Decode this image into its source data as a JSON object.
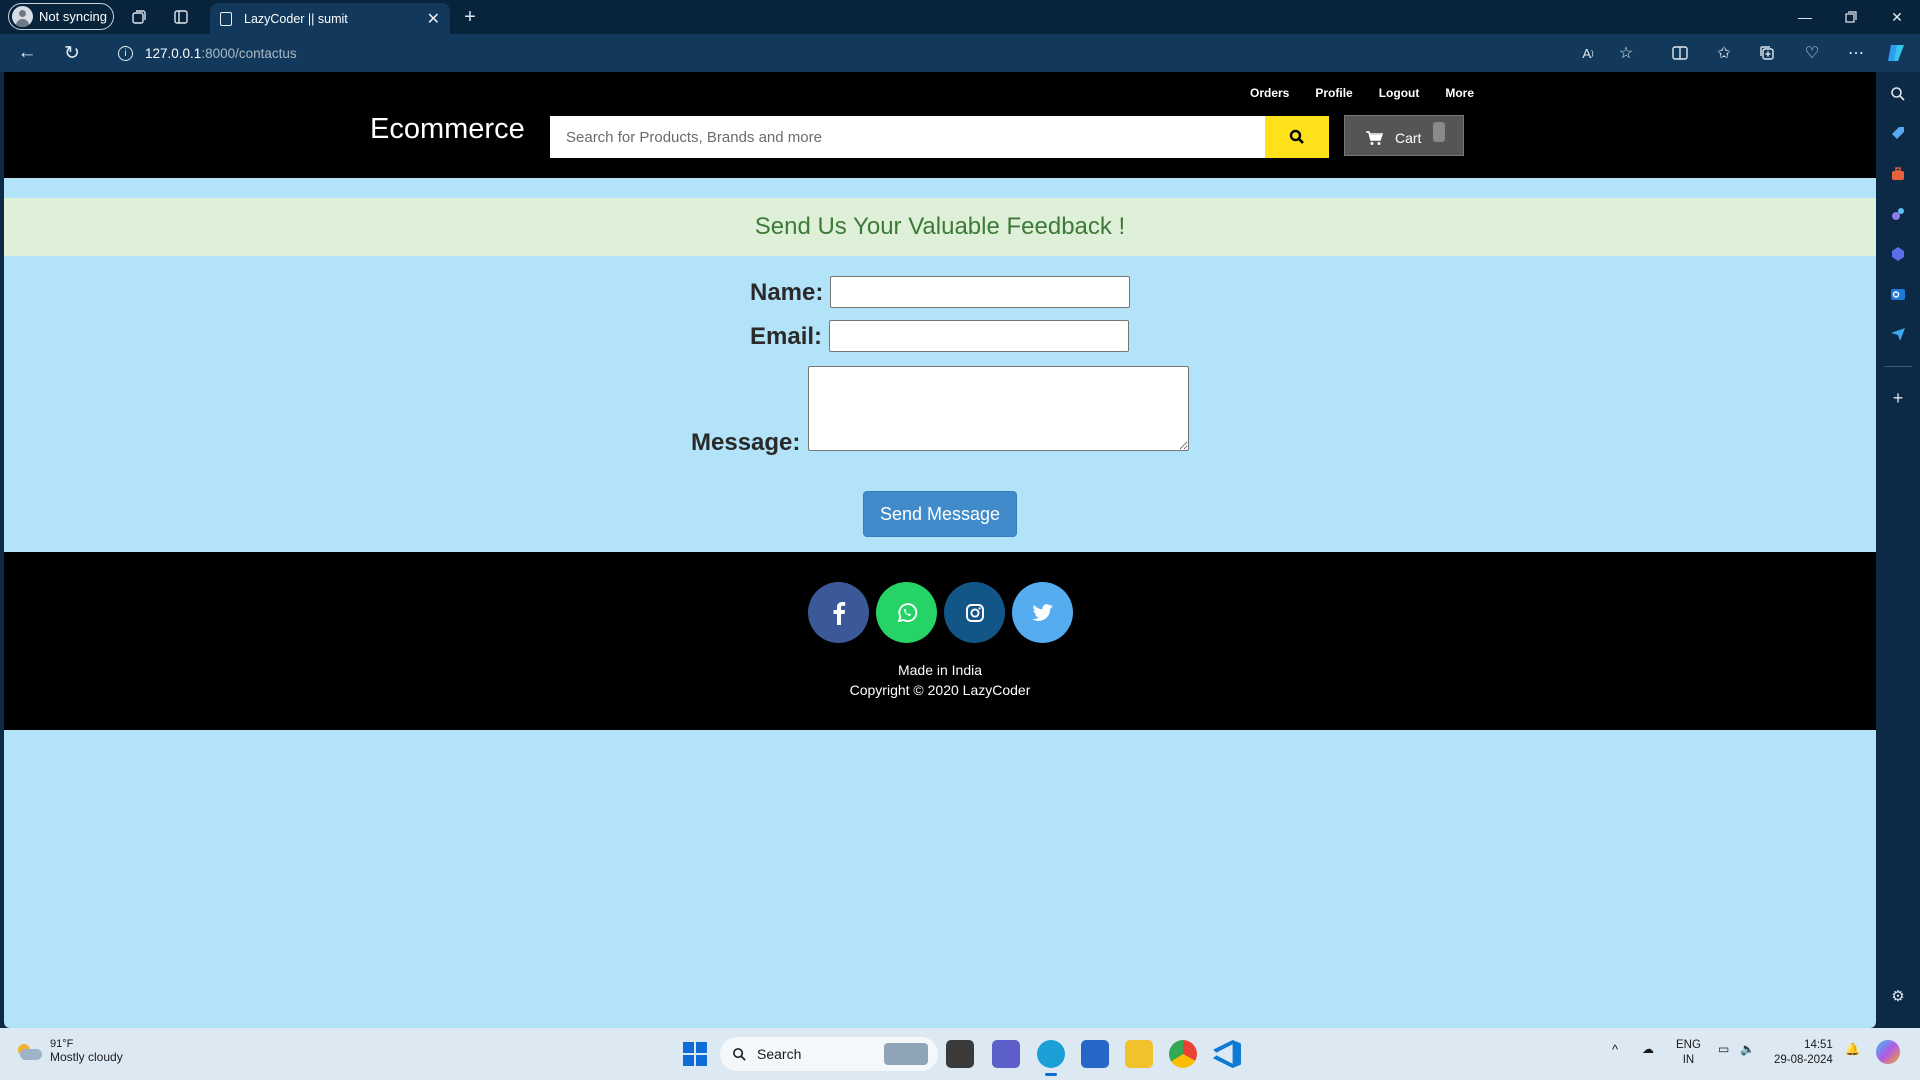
{
  "browser": {
    "profile_label": "Not syncing",
    "tab_title": "LazyCoder || sumit",
    "url_host": "127.0.0.1",
    "url_path": ":8000/contactus"
  },
  "site": {
    "brand": "Ecommerce",
    "nav_links": [
      "Orders",
      "Profile",
      "Logout",
      "More"
    ],
    "search_placeholder": "Search for Products, Brands and more",
    "cart_label": "Cart",
    "accent_yellow": "#ffe11b"
  },
  "contact": {
    "banner": "Send Us Your Valuable Feedback !",
    "name_label": "Name:",
    "email_label": "Email:",
    "message_label": "Message:",
    "name_value": "",
    "email_value": "",
    "message_value": "",
    "submit_label": "Send Message"
  },
  "footer": {
    "social": [
      {
        "name": "facebook",
        "color": "#3b5998"
      },
      {
        "name": "whatsapp",
        "color": "#25d366"
      },
      {
        "name": "instagram",
        "color": "#125688"
      },
      {
        "name": "twitter",
        "color": "#55acee"
      }
    ],
    "made_in": "Made in India",
    "copyright": "Copyright © 2020 LazyCoder"
  },
  "taskbar": {
    "temperature": "91°F",
    "weather": "Mostly cloudy",
    "search_label": "Search",
    "language": "ENG",
    "region": "IN",
    "time": "14:51",
    "date": "29-08-2024"
  }
}
